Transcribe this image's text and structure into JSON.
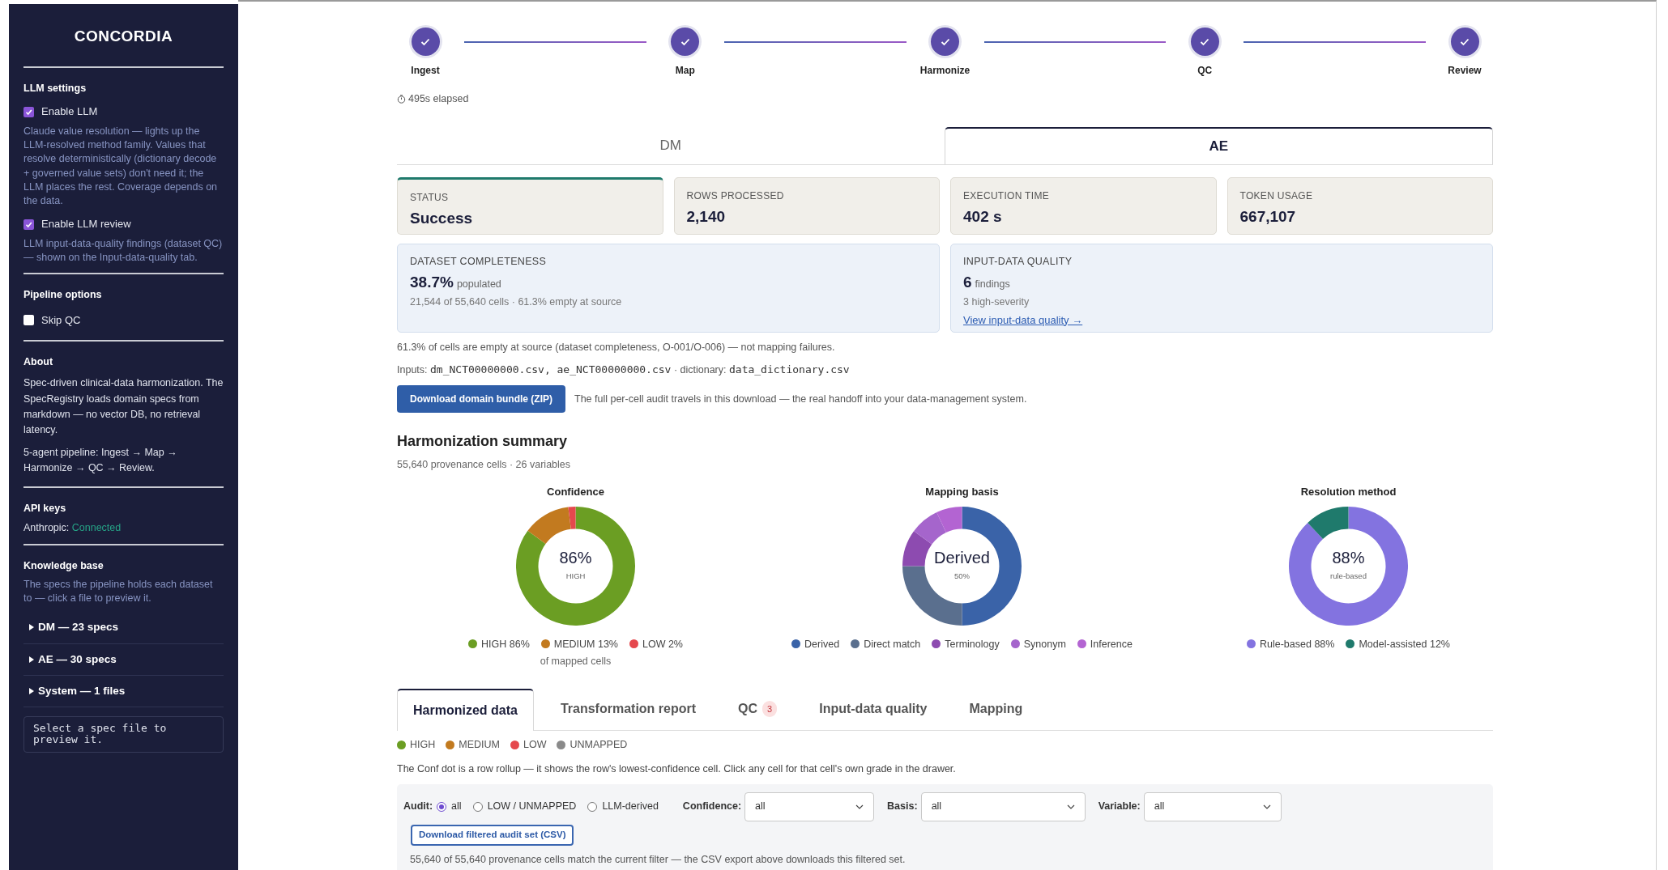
{
  "sidebar": {
    "title": "CONCORDIA",
    "llm_settings": {
      "heading": "LLM settings",
      "options": [
        {
          "label": "Enable LLM",
          "checked": true,
          "description": "Claude value resolution — lights up the LLM-resolved method family. Values that resolve deterministically (dictionary decode + governed value sets) don't need it; the LLM places the rest. Coverage depends on the data."
        },
        {
          "label": "Enable LLM review",
          "checked": true,
          "description": "LLM input-data-quality findings (dataset QC) — shown on the Input-data-quality tab."
        }
      ]
    },
    "pipeline_options": {
      "heading": "Pipeline options",
      "options": [
        {
          "label": "Skip QC",
          "checked": false
        }
      ]
    },
    "about": {
      "heading": "About",
      "paragraphs": [
        "Spec-driven clinical-data harmonization. The SpecRegistry loads domain specs from markdown — no vector DB, no retrieval latency.",
        "5-agent pipeline: Ingest → Map → Harmonize → QC → Review."
      ]
    },
    "api_keys": {
      "heading": "API keys",
      "label": "Anthropic:",
      "value": "Connected"
    },
    "knowledge_base": {
      "heading": "Knowledge base",
      "description": "The specs the pipeline holds each dataset to — click a file to preview it.",
      "groups": [
        {
          "label": "DM — 23 specs",
          "expanded": false
        },
        {
          "label": "AE — 30 specs",
          "expanded": false
        },
        {
          "label": "System — 1 files",
          "expanded": false
        }
      ],
      "preview": "Select a spec file to preview it."
    }
  },
  "stepper": {
    "steps": [
      {
        "label": "Ingest",
        "done": true
      },
      {
        "label": "Map",
        "done": true
      },
      {
        "label": "Harmonize",
        "done": true
      },
      {
        "label": "QC",
        "done": true
      },
      {
        "label": "Review",
        "done": true
      }
    ],
    "elapsed": "495s elapsed"
  },
  "dataset_tabs": [
    {
      "label": "DM",
      "selected": false
    },
    {
      "label": "AE",
      "selected": true
    }
  ],
  "metrics": [
    {
      "kind": "status",
      "label": "STATUS",
      "value": "Success"
    },
    {
      "kind": "plain",
      "label": "ROWS PROCESSED",
      "value": "2,140"
    },
    {
      "kind": "plain",
      "label": "EXECUTION TIME",
      "value": "402 s"
    },
    {
      "kind": "plain",
      "label": "TOKEN USAGE",
      "value": "667,107"
    }
  ],
  "completeness": {
    "label": "DATASET COMPLETENESS",
    "value": "38.7%",
    "unit": "populated",
    "detail": "21,544 of 55,640 cells · 61.3% empty at source"
  },
  "quality": {
    "label": "INPUT-DATA QUALITY",
    "value": "6",
    "unit": "findings",
    "detail": "3 high-severity",
    "link": "View input-data quality →"
  },
  "empty_note": "61.3% of cells are empty at source (dataset completeness, O-001/O-006) — not mapping failures.",
  "inputs": {
    "label": "Inputs:",
    "files": "dm_NCT00000000.csv, ae_NCT00000000.csv",
    "separator": "· dictionary:",
    "dictionary": "data_dictionary.csv"
  },
  "download": {
    "button": "Download domain bundle (ZIP)",
    "note": "The full per-cell audit travels in this download — the real handoff into your data-management system."
  },
  "summary": {
    "title": "Harmonization summary",
    "subtitle": "55,640 provenance cells · 26 variables",
    "charts": [
      {
        "kind": "data",
        "center_value": "86%",
        "center_label": "HIGH",
        "legend": [
          {
            "color": "#6b9e23"
          },
          {
            "color": "#c27a1f"
          },
          {
            "color": "#e5484d"
          }
        ],
        "footnote": "of mapped cells",
        "chart_data": {
          "type": "donut",
          "title": "Confidence",
          "categories": [
            "HIGH",
            "MEDIUM",
            "LOW"
          ],
          "values": [
            86,
            13,
            2
          ],
          "value_labels": [
            "86%",
            "13%",
            "2%"
          ]
        }
      },
      {
        "kind": "picture",
        "title": "Mapping basis",
        "center_value": "Derived",
        "center_label": "50%",
        "legend": [
          {
            "label": "Derived",
            "color": "#3a63a8"
          },
          {
            "label": "Direct match",
            "color": "#5a6f8e"
          },
          {
            "label": "Terminology",
            "color": "#8d4bb0"
          },
          {
            "label": "Synonym",
            "color": "#a565cc"
          },
          {
            "label": "Inference",
            "color": "#b364d2"
          }
        ]
      },
      {
        "kind": "data",
        "center_value": "88%",
        "center_label": "rule-based",
        "legend": [
          {
            "color": "#8373e0"
          },
          {
            "color": "#1f7a6c"
          }
        ],
        "chart_data": {
          "type": "donut",
          "title": "Resolution method",
          "categories": [
            "Rule-based",
            "Model-assisted"
          ],
          "values": [
            88,
            12
          ],
          "value_labels": [
            "88%",
            "12%"
          ]
        }
      }
    ]
  },
  "lower_tabs": [
    {
      "label": "Harmonized data",
      "selected": true
    },
    {
      "label": "Transformation report",
      "selected": false
    },
    {
      "label": "QC",
      "selected": false,
      "badge": "3"
    },
    {
      "label": "Input-data quality",
      "selected": false
    },
    {
      "label": "Mapping",
      "selected": false
    }
  ],
  "grade_legend": [
    {
      "label": "HIGH",
      "color": "#6b9e23"
    },
    {
      "label": "MEDIUM",
      "color": "#c27a1f"
    },
    {
      "label": "LOW",
      "color": "#e5484d"
    },
    {
      "label": "UNMAPPED",
      "color": "#8a8a8a"
    }
  ],
  "conf_note": "The Conf dot is a row rollup — it shows the row's lowest-confidence cell. Click any cell for that cell's own grade in the drawer.",
  "filters": {
    "audit_label": "Audit:",
    "audit_options": [
      {
        "label": "all",
        "selected": true
      },
      {
        "label": "LOW / UNMAPPED",
        "selected": false
      },
      {
        "label": "LLM-derived",
        "selected": false
      }
    ],
    "selects": [
      {
        "label": "Confidence:",
        "value": "all"
      },
      {
        "label": "Basis:",
        "value": "all"
      },
      {
        "label": "Variable:",
        "value": "all"
      }
    ],
    "button": "Download filtered audit set (CSV)",
    "match_note": "55,640 of 55,640 provenance cells match the current filter — the CSV export above downloads this filtered set."
  }
}
